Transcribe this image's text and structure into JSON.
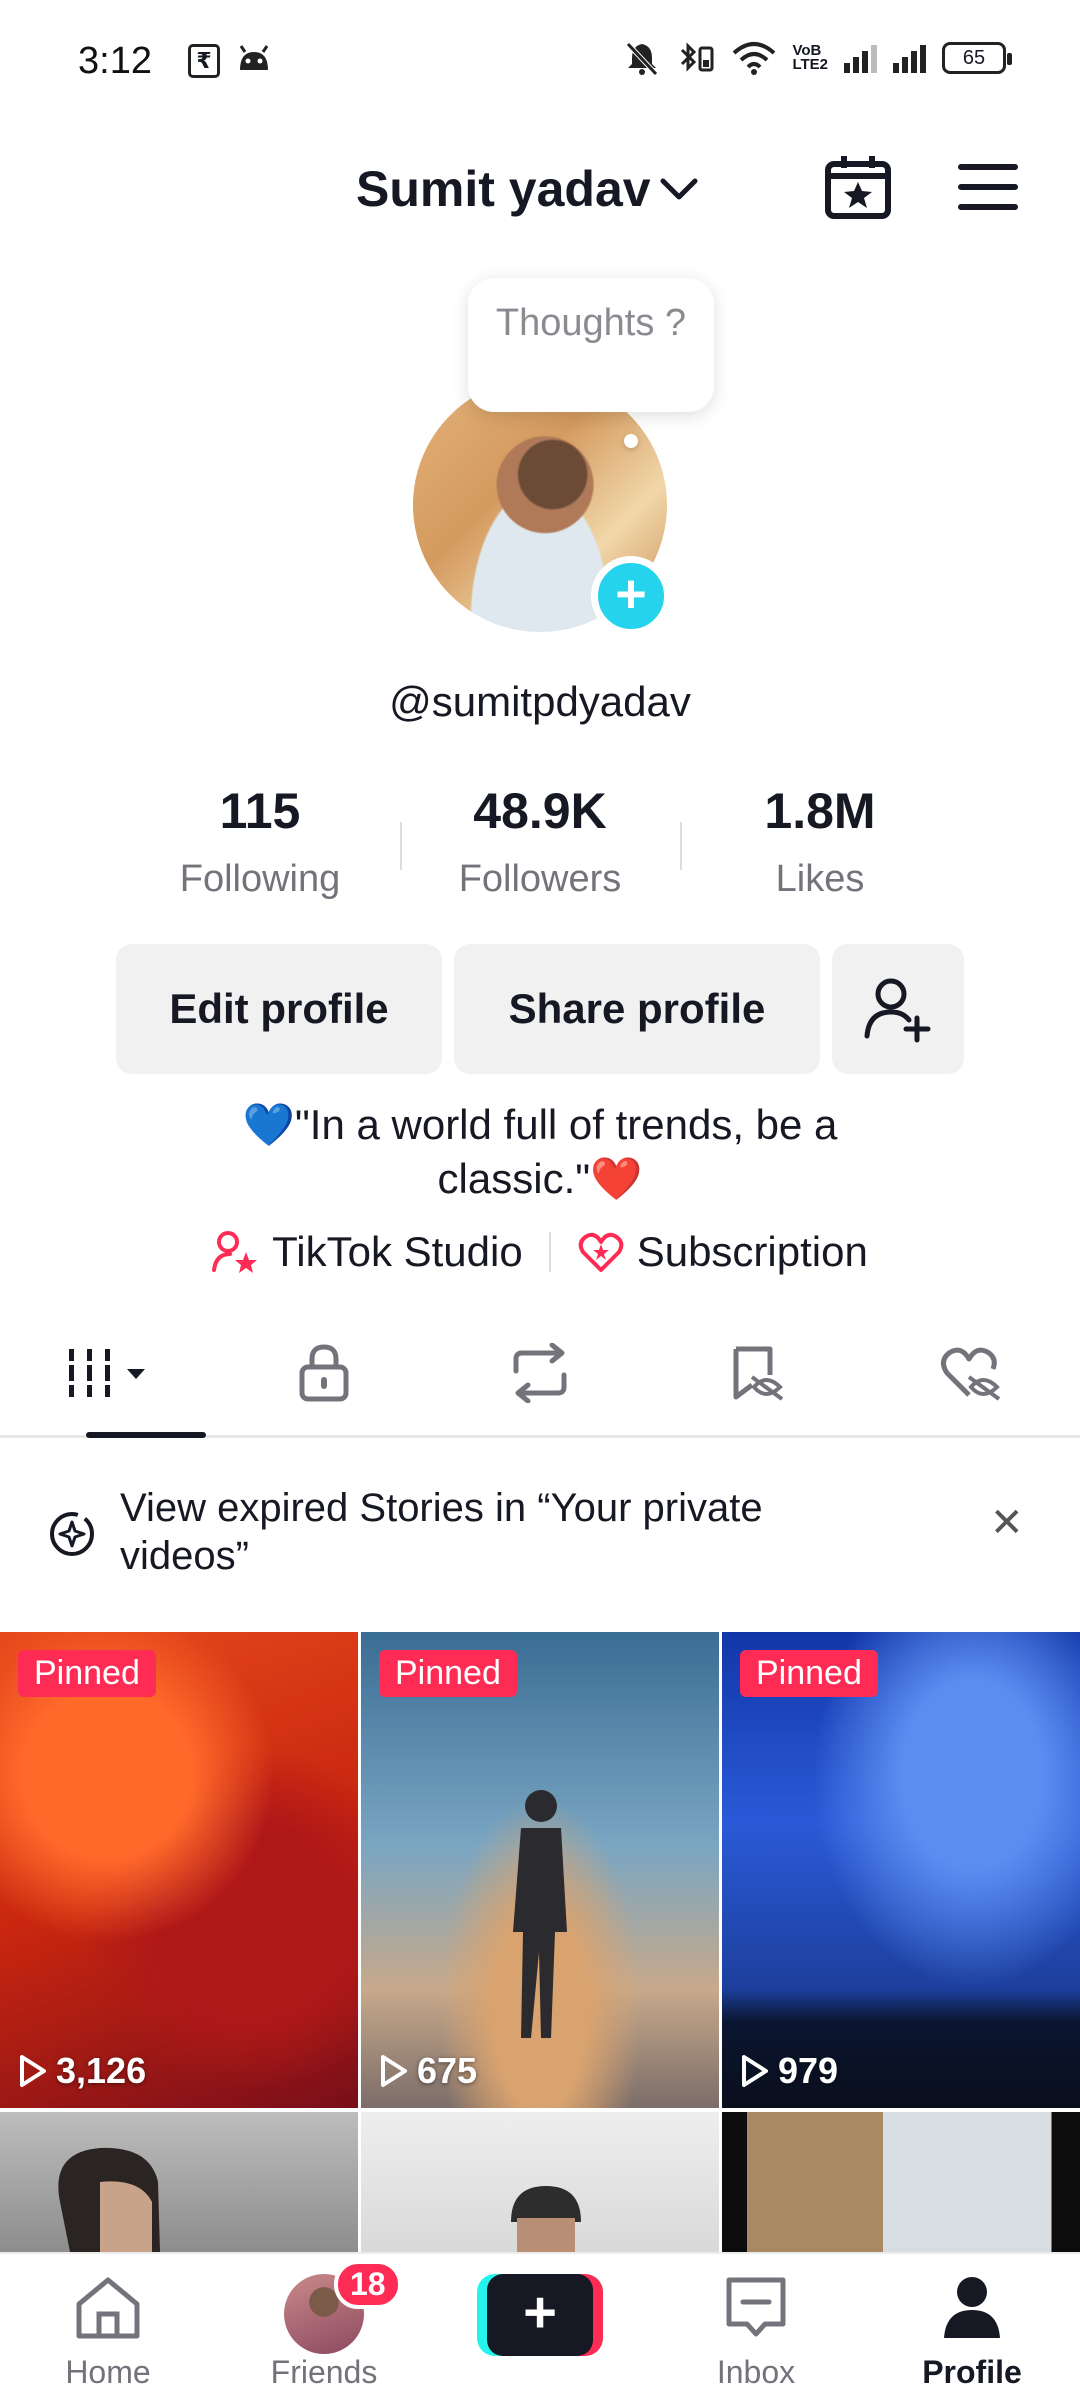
{
  "status_bar": {
    "time": "3:12",
    "rupee_icon": "₹",
    "battery": "65",
    "network": "VoLTE2"
  },
  "header": {
    "title": "Sumit yadav"
  },
  "thought_bubble": {
    "text": "Thoughts ?"
  },
  "profile": {
    "handle": "@sumitpdyadav",
    "stats": [
      {
        "value": "115",
        "label": "Following"
      },
      {
        "value": "48.9K",
        "label": "Followers"
      },
      {
        "value": "1.8M",
        "label": "Likes"
      }
    ],
    "buttons": {
      "edit": "Edit profile",
      "share": "Share profile"
    },
    "bio_line1": "💙\"In a world full of trends, be a",
    "bio_line2": "classic.\"❤️",
    "links": {
      "studio": "TikTok Studio",
      "subscription": "Subscription"
    }
  },
  "banner": {
    "text": "View expired Stories in “Your private videos”"
  },
  "videos": [
    {
      "pinned": "Pinned",
      "views": "3,126"
    },
    {
      "pinned": "Pinned",
      "views": "675"
    },
    {
      "pinned": "Pinned",
      "views": "979"
    }
  ],
  "nav": {
    "home": "Home",
    "friends": "Friends",
    "friends_badge": "18",
    "inbox": "Inbox",
    "profile": "Profile"
  },
  "colors": {
    "accent": "#fe2c55",
    "story_add": "#25d3ec",
    "text": "#161823",
    "secondary_text": "#73747b"
  }
}
